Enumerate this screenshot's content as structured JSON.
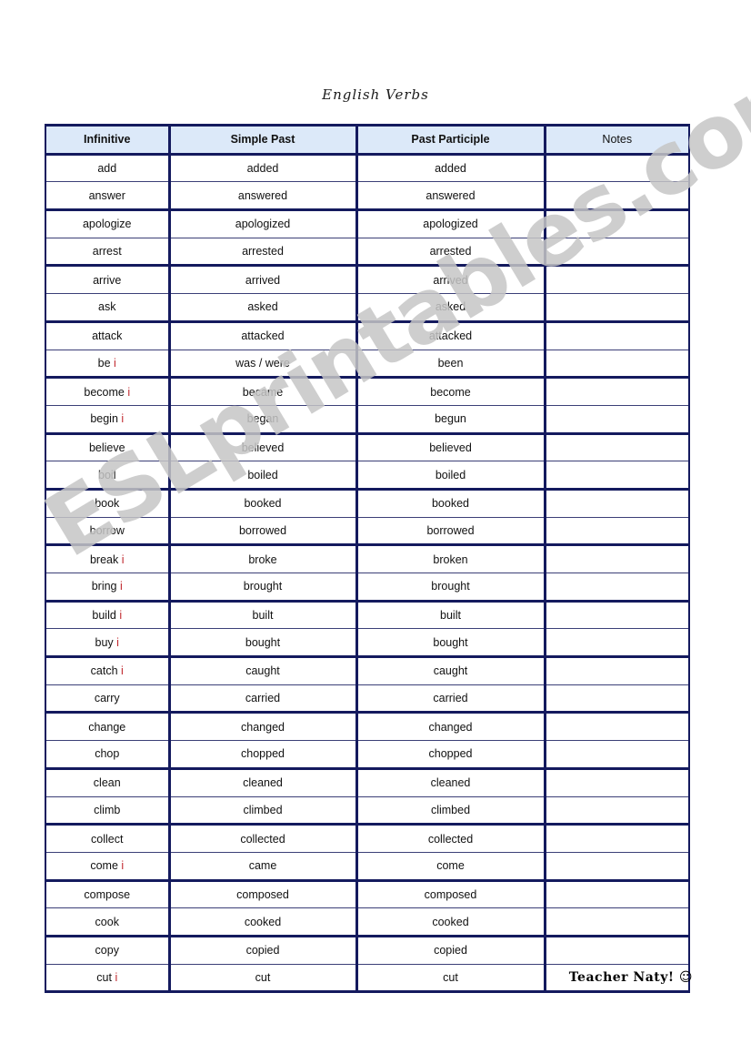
{
  "document": {
    "title": "English Verbs"
  },
  "watermark": {
    "text": "ESLprintables.com",
    "color": "#c6c6c6"
  },
  "footer": {
    "credit": "Teacher Naty!",
    "smiley_icon": "☺"
  },
  "table": {
    "columns": [
      "Infinitive",
      "Simple Past",
      "Past Participle",
      "Notes"
    ],
    "irregular_marker": "i",
    "irregular_marker_color": "#c0272d",
    "header_background": "#dce9f9",
    "border_color": "#141a5e",
    "rows": [
      {
        "infinitive": "add",
        "irregular": false,
        "simple_past": "added",
        "past_participle": "added",
        "notes": ""
      },
      {
        "infinitive": "answer",
        "irregular": false,
        "simple_past": "answered",
        "past_participle": "answered",
        "notes": ""
      },
      {
        "infinitive": "apologize",
        "irregular": false,
        "simple_past": "apologized",
        "past_participle": "apologized",
        "notes": ""
      },
      {
        "infinitive": "arrest",
        "irregular": false,
        "simple_past": "arrested",
        "past_participle": "arrested",
        "notes": ""
      },
      {
        "infinitive": "arrive",
        "irregular": false,
        "simple_past": "arrived",
        "past_participle": "arrived",
        "notes": ""
      },
      {
        "infinitive": "ask",
        "irregular": false,
        "simple_past": "asked",
        "past_participle": "asked",
        "notes": ""
      },
      {
        "infinitive": "attack",
        "irregular": false,
        "simple_past": "attacked",
        "past_participle": "attacked",
        "notes": ""
      },
      {
        "infinitive": "be",
        "irregular": true,
        "simple_past": "was / were",
        "past_participle": "been",
        "notes": ""
      },
      {
        "infinitive": "become",
        "irregular": true,
        "simple_past": "became",
        "past_participle": "become",
        "notes": ""
      },
      {
        "infinitive": "begin",
        "irregular": true,
        "simple_past": "began",
        "past_participle": "begun",
        "notes": ""
      },
      {
        "infinitive": "believe",
        "irregular": false,
        "simple_past": "believed",
        "past_participle": "believed",
        "notes": ""
      },
      {
        "infinitive": "boil",
        "irregular": false,
        "simple_past": "boiled",
        "past_participle": "boiled",
        "notes": ""
      },
      {
        "infinitive": "book",
        "irregular": false,
        "simple_past": "booked",
        "past_participle": "booked",
        "notes": ""
      },
      {
        "infinitive": "borrow",
        "irregular": false,
        "simple_past": "borrowed",
        "past_participle": "borrowed",
        "notes": ""
      },
      {
        "infinitive": "break",
        "irregular": true,
        "simple_past": "broke",
        "past_participle": "broken",
        "notes": ""
      },
      {
        "infinitive": "bring",
        "irregular": true,
        "simple_past": "brought",
        "past_participle": "brought",
        "notes": ""
      },
      {
        "infinitive": "build",
        "irregular": true,
        "simple_past": "built",
        "past_participle": "built",
        "notes": ""
      },
      {
        "infinitive": "buy",
        "irregular": true,
        "simple_past": "bought",
        "past_participle": "bought",
        "notes": ""
      },
      {
        "infinitive": "catch",
        "irregular": true,
        "simple_past": "caught",
        "past_participle": "caught",
        "notes": ""
      },
      {
        "infinitive": "carry",
        "irregular": false,
        "simple_past": "carried",
        "past_participle": "carried",
        "notes": ""
      },
      {
        "infinitive": "change",
        "irregular": false,
        "simple_past": "changed",
        "past_participle": "changed",
        "notes": ""
      },
      {
        "infinitive": "chop",
        "irregular": false,
        "simple_past": "chopped",
        "past_participle": "chopped",
        "notes": ""
      },
      {
        "infinitive": "clean",
        "irregular": false,
        "simple_past": "cleaned",
        "past_participle": "cleaned",
        "notes": ""
      },
      {
        "infinitive": "climb",
        "irregular": false,
        "simple_past": "climbed",
        "past_participle": "climbed",
        "notes": ""
      },
      {
        "infinitive": "collect",
        "irregular": false,
        "simple_past": "collected",
        "past_participle": "collected",
        "notes": ""
      },
      {
        "infinitive": "come",
        "irregular": true,
        "simple_past": "came",
        "past_participle": "come",
        "notes": ""
      },
      {
        "infinitive": "compose",
        "irregular": false,
        "simple_past": "composed",
        "past_participle": "composed",
        "notes": ""
      },
      {
        "infinitive": "cook",
        "irregular": false,
        "simple_past": "cooked",
        "past_participle": "cooked",
        "notes": ""
      },
      {
        "infinitive": "copy",
        "irregular": false,
        "simple_past": "copied",
        "past_participle": "copied",
        "notes": ""
      },
      {
        "infinitive": "cut",
        "irregular": true,
        "simple_past": "cut",
        "past_participle": "cut",
        "notes": ""
      }
    ]
  }
}
